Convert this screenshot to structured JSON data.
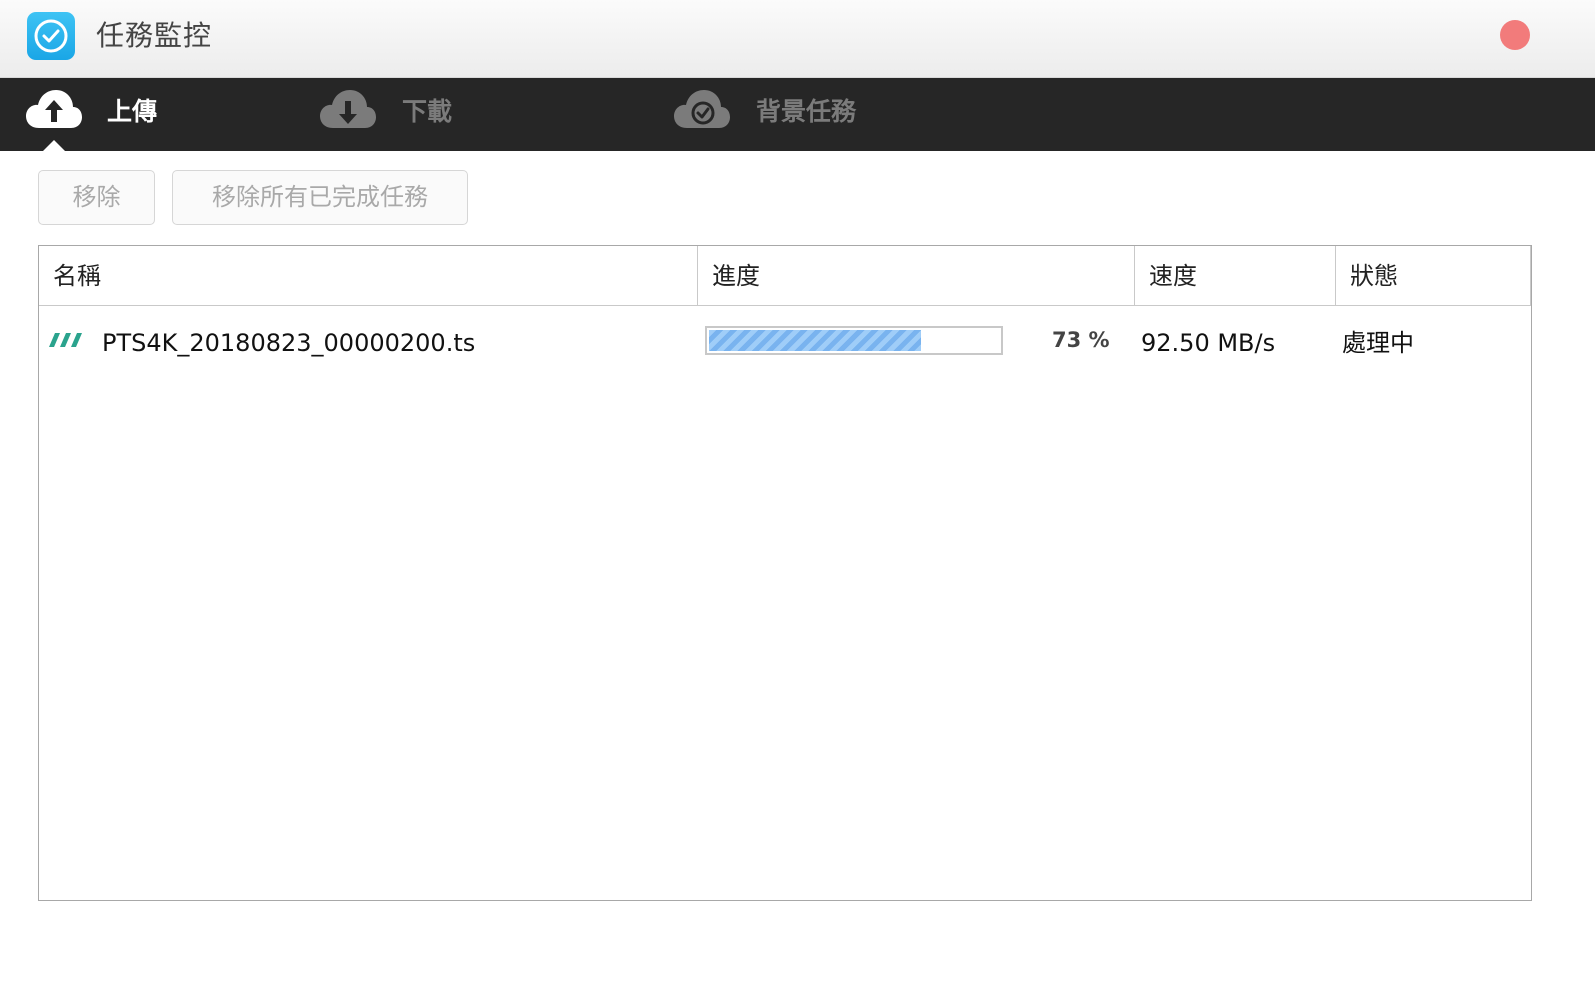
{
  "window": {
    "title": "任務監控",
    "icon": "check-circle-icon"
  },
  "colors": {
    "app_icon": "#1aa6e6",
    "close_button": "#f27b7b",
    "tab_bar": "#262626",
    "progress_fill": "#79b3ef"
  },
  "tabs": [
    {
      "label": "上傳",
      "icon": "cloud-upload-icon",
      "active": true
    },
    {
      "label": "下載",
      "icon": "cloud-download-icon",
      "active": false
    },
    {
      "label": "背景任務",
      "icon": "cloud-check-icon",
      "active": false
    }
  ],
  "toolbar": {
    "remove_label": "移除",
    "remove_all_done_label": "移除所有已完成任務"
  },
  "table": {
    "columns": [
      "名稱",
      "進度",
      "速度",
      "狀態"
    ],
    "rows": [
      {
        "icon": "striped-file-icon",
        "name": "PTS4K_20180823_00000200.ts",
        "progress": 73,
        "progress_text": "73 %",
        "speed": "92.50 MB/s",
        "status": "處理中"
      }
    ]
  }
}
